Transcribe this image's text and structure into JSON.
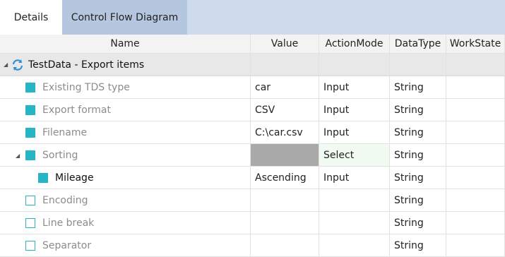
{
  "tabs": [
    {
      "label": "Details",
      "active": true
    },
    {
      "label": "Control Flow Diagram",
      "active": false
    }
  ],
  "columns": [
    "Name",
    "Value",
    "ActionMode",
    "DataType",
    "WorkState"
  ],
  "group": {
    "label": "TestData - Export items",
    "icon": "refresh-icon"
  },
  "rows": [
    {
      "name": "Existing TDS type",
      "value": "car",
      "action": "Input",
      "datatype": "String",
      "workstate": ""
    },
    {
      "name": "Export format",
      "value": "CSV",
      "action": "Input",
      "datatype": "String",
      "workstate": ""
    },
    {
      "name": "Filename",
      "value": "C:\\car.csv",
      "action": "Input",
      "datatype": "String",
      "workstate": ""
    },
    {
      "name": "Sorting",
      "value": "",
      "action": "Select",
      "datatype": "String",
      "workstate": ""
    },
    {
      "name": "Mileage",
      "value": "Ascending",
      "action": "Input",
      "datatype": "String",
      "workstate": ""
    },
    {
      "name": "Encoding",
      "value": "",
      "action": "",
      "datatype": "String",
      "workstate": ""
    },
    {
      "name": "Line break",
      "value": "",
      "action": "",
      "datatype": "String",
      "workstate": ""
    },
    {
      "name": "Separator",
      "value": "",
      "action": "",
      "datatype": "String",
      "workstate": ""
    }
  ],
  "colors": {
    "accent": "#26b5c4",
    "tabbar": "#cfdceb",
    "inactive_tab": "#b4c7de",
    "group_row": "#e8e8e8",
    "value_disabled": "#a9a9a9"
  }
}
